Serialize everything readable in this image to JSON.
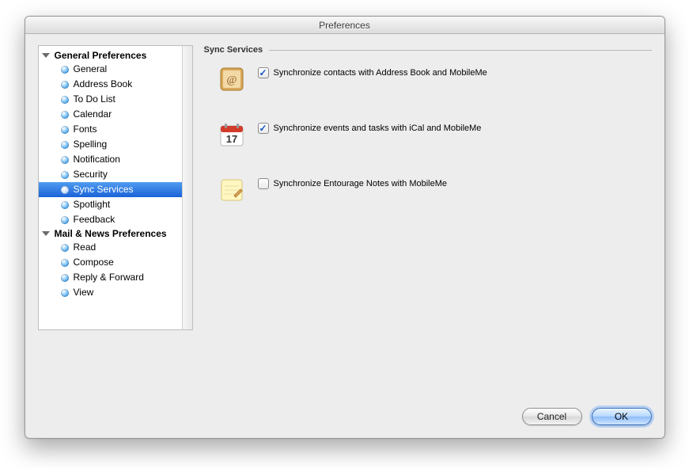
{
  "window": {
    "title": "Preferences"
  },
  "sidebar": {
    "groups": [
      {
        "title": "General Preferences",
        "items": [
          {
            "label": "General",
            "selected": false
          },
          {
            "label": "Address Book",
            "selected": false
          },
          {
            "label": "To Do List",
            "selected": false
          },
          {
            "label": "Calendar",
            "selected": false
          },
          {
            "label": "Fonts",
            "selected": false
          },
          {
            "label": "Spelling",
            "selected": false
          },
          {
            "label": "Notification",
            "selected": false
          },
          {
            "label": "Security",
            "selected": false
          },
          {
            "label": "Sync Services",
            "selected": true
          },
          {
            "label": "Spotlight",
            "selected": false
          },
          {
            "label": "Feedback",
            "selected": false
          }
        ]
      },
      {
        "title": "Mail & News Preferences",
        "items": [
          {
            "label": "Read",
            "selected": false
          },
          {
            "label": "Compose",
            "selected": false
          },
          {
            "label": "Reply & Forward",
            "selected": false
          },
          {
            "label": "View",
            "selected": false
          }
        ]
      }
    ]
  },
  "section": {
    "title": "Sync Services"
  },
  "options": [
    {
      "icon": "address-book-icon",
      "checked": true,
      "label": "Synchronize contacts with Address Book and MobileMe"
    },
    {
      "icon": "calendar-icon",
      "checked": true,
      "label": "Synchronize events and tasks with iCal and MobileMe"
    },
    {
      "icon": "notes-icon",
      "checked": false,
      "label": "Synchronize Entourage Notes with MobileMe"
    }
  ],
  "buttons": {
    "cancel": "Cancel",
    "ok": "OK"
  }
}
